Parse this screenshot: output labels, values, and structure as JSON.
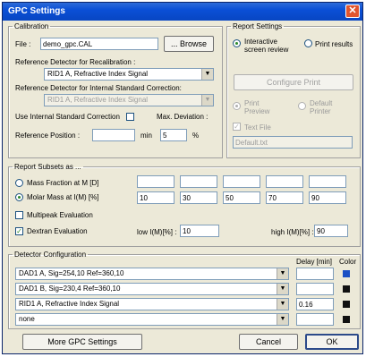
{
  "window": {
    "title": "GPC Settings",
    "close": "✕"
  },
  "calibration": {
    "legend": "Calibration",
    "file_label": "File :",
    "file_value": "demo_gpc.CAL",
    "browse_label": "... Browse",
    "recal_label": "Reference Detector for Recalibration :",
    "recal_value": "RID1 A, Refractive Index Signal",
    "internal_label": "Reference Detector for Internal Standard Correction:",
    "internal_value": "RID1 A, Refractive Index Signal",
    "use_internal_label": "Use Internal Standard Correction",
    "max_dev_label": "Max. Deviation :",
    "ref_pos_label": "Reference Position :",
    "ref_pos_value": "",
    "min_label": "min",
    "max_dev_value": "5",
    "pct_label": "%"
  },
  "report": {
    "legend": "Report Settings",
    "interactive_label": "Interactive screen review",
    "print_results_label": "Print results",
    "configure_print_label": "Configure Print",
    "print_preview_label": "Print Preview",
    "default_printer_label": "Default Printer",
    "text_file_label": "Text File",
    "text_file_value": "Default.txt"
  },
  "subsets": {
    "legend": "Report Subsets as ...",
    "mass_fraction_label": "Mass Fraction at M [D]",
    "molar_mass_label": "Molar Mass at I(M) [%]",
    "multipeak_label": "Multipeak Evaluation",
    "dextran_label": "Dextran Evaluation",
    "top_values": [
      "",
      "",
      "",
      "",
      ""
    ],
    "values": [
      "10",
      "30",
      "50",
      "70",
      "90"
    ],
    "low_label": "low I(M)[%] :",
    "low_value": "10",
    "high_label": "high I(M)[%] :",
    "high_value": "90"
  },
  "detectors": {
    "legend": "Detector Configuration",
    "delay_header": "Delay [min]",
    "color_header": "Color",
    "rows": [
      {
        "name": "DAD1 A, Sig=254,10 Ref=360,10",
        "delay": "",
        "color": "#1a4fc4"
      },
      {
        "name": "DAD1 B, Sig=230,4 Ref=360,10",
        "delay": "",
        "color": "#111111"
      },
      {
        "name": "RID1 A, Refractive Index Signal",
        "delay": "0.16",
        "color": "#111111"
      },
      {
        "name": "none",
        "delay": "",
        "color": "#111111"
      }
    ]
  },
  "footer": {
    "more_label": "More GPC Settings",
    "cancel_label": "Cancel",
    "ok_label": "OK"
  }
}
